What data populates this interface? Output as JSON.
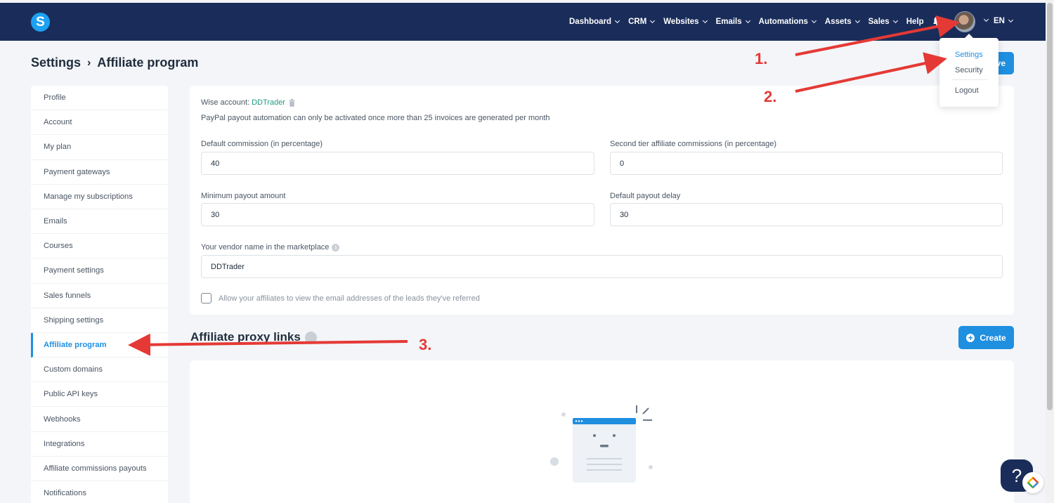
{
  "app": {
    "logo_letter": "S"
  },
  "nav": {
    "items": [
      {
        "label": "Dashboard",
        "has_menu": true
      },
      {
        "label": "CRM",
        "has_menu": true
      },
      {
        "label": "Websites",
        "has_menu": true
      },
      {
        "label": "Emails",
        "has_menu": true
      },
      {
        "label": "Automations",
        "has_menu": true
      },
      {
        "label": "Assets",
        "has_menu": true
      },
      {
        "label": "Sales",
        "has_menu": true
      },
      {
        "label": "Help",
        "has_menu": false
      }
    ],
    "language": "EN"
  },
  "breadcrumb": {
    "parent": "Settings",
    "separator": "›",
    "current": "Affiliate program"
  },
  "save_button": {
    "label": "ve"
  },
  "account_menu": {
    "items": [
      "Settings",
      "Security",
      "Logout"
    ],
    "active": "Settings"
  },
  "sidebar": {
    "items": [
      "Profile",
      "Account",
      "My plan",
      "Payment gateways",
      "Manage my subscriptions",
      "Emails",
      "Courses",
      "Payment settings",
      "Sales funnels",
      "Shipping settings",
      "Affiliate program",
      "Custom domains",
      "Public API keys",
      "Webhooks",
      "Integrations",
      "Affiliate commissions payouts",
      "Notifications"
    ],
    "active": "Affiliate program"
  },
  "form": {
    "wise_label": "Wise account:",
    "wise_account": "DDTrader",
    "paypal_note": "PayPal payout automation can only be activated once more than 25 invoices are generated per month",
    "default_commission": {
      "label": "Default commission (in percentage)",
      "value": "40"
    },
    "second_tier": {
      "label": "Second tier affiliate commissions (in percentage)",
      "value": "0"
    },
    "min_payout": {
      "label": "Minimum payout amount",
      "value": "30"
    },
    "payout_delay": {
      "label": "Default payout delay",
      "value": "30"
    },
    "vendor_name": {
      "label": "Your vendor name in the marketplace",
      "value": "DDTrader"
    },
    "allow_emails": {
      "label": "Allow your affiliates to view the email addresses of the leads they've referred",
      "checked": false
    }
  },
  "proxy_links": {
    "title": "Affiliate proxy links",
    "create_label": "Create"
  },
  "help": {
    "label": "?"
  },
  "annotations": {
    "step1": "1.",
    "step2": "2.",
    "step3": "3."
  },
  "colors": {
    "nav_bg": "#1a2d5a",
    "accent": "#1f8fe0",
    "annotation": "#e53935"
  }
}
